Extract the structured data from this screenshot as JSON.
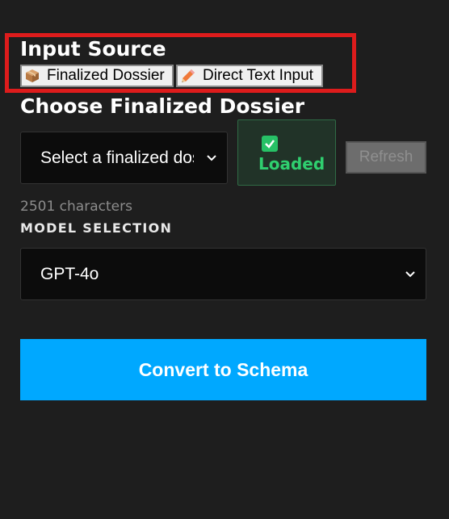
{
  "input_source": {
    "heading": "Input Source",
    "buttons": [
      {
        "label": "Finalized Dossier",
        "icon": "package-icon"
      },
      {
        "label": "Direct Text Input",
        "icon": "pencil-icon"
      }
    ]
  },
  "dossier": {
    "heading": "Choose Finalized Dossier",
    "select_value": "Select a finalized dossier",
    "status_label": "Loaded",
    "refresh_label": "Refresh",
    "char_count": "2501 characters"
  },
  "model": {
    "label": "MODEL SELECTION",
    "selected": "GPT-4o"
  },
  "actions": {
    "convert_label": "Convert to Schema"
  },
  "colors": {
    "background": "#1e1e1e",
    "highlight": "#dd1c1c",
    "accent": "#00a8ff",
    "success": "#2fcf6f"
  }
}
